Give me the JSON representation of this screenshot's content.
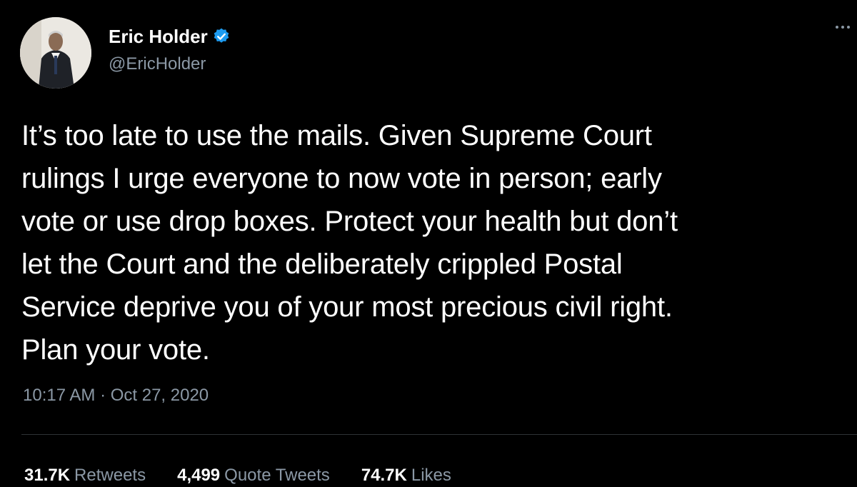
{
  "author": {
    "display_name": "Eric Holder",
    "handle": "@EricHolder",
    "verified": true
  },
  "tweet": {
    "text": "It’s too late to use the mails. Given Supreme Court\nrulings I urge everyone to now vote in person; early\nvote or use drop boxes. Protect your health but don’t\nlet the Court and the deliberately crippled Postal\nService deprive you of your most precious civil right.\nPlan your vote.",
    "timestamp": "10:17 AM · Oct 27, 2020"
  },
  "stats": [
    {
      "count": "31.7K",
      "label": "Retweets"
    },
    {
      "count": "4,499",
      "label": "Quote Tweets"
    },
    {
      "count": "74.7K",
      "label": "Likes"
    }
  ],
  "icons": {
    "verified": "verified-badge-icon",
    "more": "more-options-icon"
  },
  "colors": {
    "background": "#000000",
    "text": "#ffffff",
    "secondary": "#8b98a5",
    "verified": "#1d9bf0"
  }
}
